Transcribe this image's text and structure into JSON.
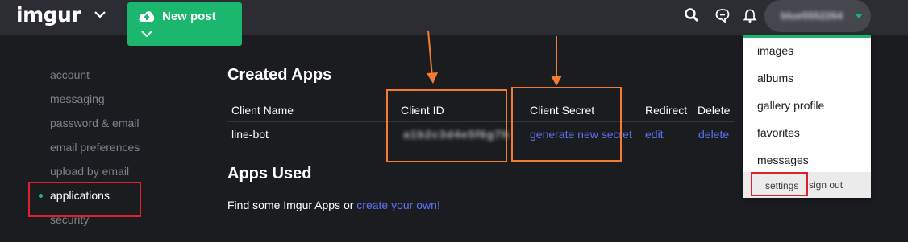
{
  "header": {
    "logo": "imgur",
    "new_post_label": "New post",
    "username": "blue5552264",
    "icons": [
      "search-icon",
      "chat-icon",
      "bell-icon"
    ]
  },
  "sidebar": {
    "items": [
      {
        "label": "account"
      },
      {
        "label": "messaging"
      },
      {
        "label": "password & email"
      },
      {
        "label": "email preferences"
      },
      {
        "label": "upload by email"
      },
      {
        "label": "applications",
        "active": true
      },
      {
        "label": "security"
      }
    ]
  },
  "main": {
    "created_apps_title": "Created Apps",
    "table": {
      "headers": [
        "Client Name",
        "Client ID",
        "Client Secret",
        "Redirect",
        "Delete"
      ],
      "rows": [
        {
          "client_name": "line-bot",
          "client_id": "a1b2c3d4e5f6g7h",
          "secret_link": "generate new secret",
          "redirect_link": "edit",
          "delete_link": "delete"
        }
      ]
    },
    "apps_used_title": "Apps Used",
    "apps_used_text": "Find some Imgur Apps or",
    "apps_used_link": "create your own!"
  },
  "user_menu": {
    "items": [
      "images",
      "albums",
      "gallery profile",
      "favorites",
      "messages"
    ],
    "settings_label": "settings",
    "sign_out_label": "sign out"
  },
  "colors": {
    "accent_green": "#1bb76e",
    "link_blue": "#5b73f5",
    "annotation_orange": "#f37c2f",
    "annotation_red": "#e0202a",
    "background": "#1b1c20"
  }
}
